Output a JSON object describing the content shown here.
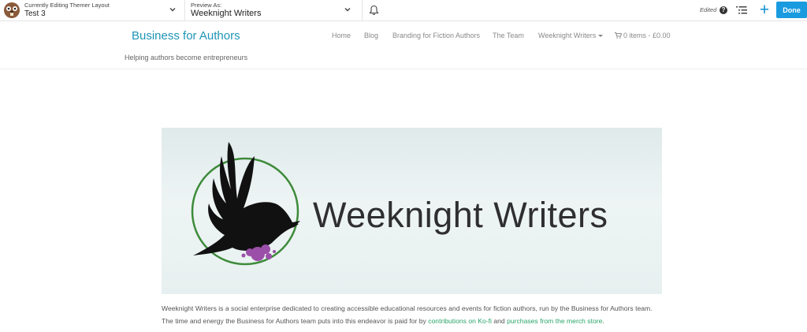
{
  "builder_bar": {
    "layout_selector": {
      "label": "Currently Editing Themer Layout",
      "value": "Test 3"
    },
    "preview_selector": {
      "label": "Preview As:",
      "value": "Weeknight Writers"
    },
    "status": "Edited",
    "done_label": "Done",
    "icons": [
      "beaver-logo-icon",
      "chevron-down-icon",
      "bell-icon",
      "help-icon",
      "outline-icon",
      "plus-icon"
    ]
  },
  "site": {
    "title": "Business for Authors",
    "tagline": "Helping authors become entrepreneurs",
    "nav": [
      {
        "label": "Home"
      },
      {
        "label": "Blog"
      },
      {
        "label": "Branding for Fiction Authors"
      },
      {
        "label": "The Team"
      },
      {
        "label": "Weeknight Writers"
      }
    ],
    "cart": "0 items - £0.00"
  },
  "content": {
    "banner_title": "Weeknight Writers",
    "desc_line1": "Weeknight Writers is a social enterprise dedicated to creating accessible educational resources and events for fiction authors, run by the Business for Authors team.",
    "desc_line2_pre": "The time and energy the Business for Authors team puts into this endeavor is paid for by ",
    "link_kofi": "contributions on Ko-fi",
    "desc_and": " and ",
    "link_merch": "purchases from the merch store",
    "desc_end": "."
  },
  "colors": {
    "site_title": "#1e95b5",
    "accent_button": "#1a9be0",
    "link": "#2aa56a",
    "logo_circle": "#3d8b3a",
    "logo_splash": "#9b4fa8"
  }
}
